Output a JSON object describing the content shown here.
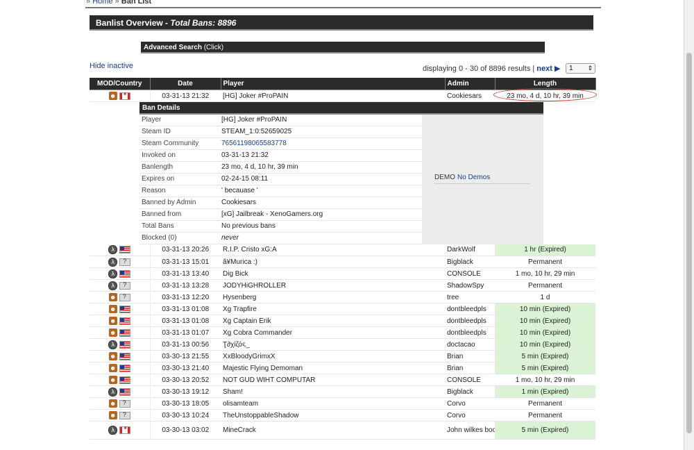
{
  "breadcrumb": {
    "home": "Home",
    "sep": "»",
    "current": "Ban List"
  },
  "overview": {
    "title": "Banlist Overview - ",
    "total": "Total Bans: 8896"
  },
  "advanced_search": {
    "label": "Advanced Search",
    "hint": " (Click)"
  },
  "hide_inactive": "Hide inactive",
  "pager": {
    "displaying": "displaying 0 - 30 of 8896 results | ",
    "next": "next ▶",
    "page": "1"
  },
  "columns": {
    "mod": "MOD/Country",
    "date": "Date",
    "player": "Player",
    "admin": "Admin",
    "length": "Length"
  },
  "first_ban": {
    "icon": "cs-icon",
    "flag": "ca",
    "date": "03-31-13 21:32",
    "player": "[HG] Joker #ProPAIN",
    "admin": "Cookiesars",
    "length": "23 mo, 4 d, 10 hr, 39 min"
  },
  "details": {
    "header": "Ban Details",
    "rows": [
      {
        "label": "Player",
        "value": "[HG] Joker #ProPAIN"
      },
      {
        "label": "Steam ID",
        "value": "STEAM_1:0:52659025"
      },
      {
        "label": "Steam Community",
        "value": "76561198065583778",
        "link": true
      },
      {
        "label": "Invoked on",
        "value": "03-31-13 21:32"
      },
      {
        "label": "Banlength",
        "value": "23 mo, 4 d, 10 hr, 39 min"
      },
      {
        "label": "Expires on",
        "value": "02-24-15 08:11"
      },
      {
        "label": "Reason",
        "value": "' becauase '"
      },
      {
        "label": "Banned by Admin",
        "value": "Cookiesars"
      },
      {
        "label": "Banned from",
        "value": "[xG] Jailbreak - XenoGamers.org"
      },
      {
        "label": "Total Bans",
        "value": "No previous bans"
      },
      {
        "label": "Blocked (0)",
        "value": "never",
        "italic": true
      }
    ],
    "demo": "No Demos",
    "demo_icon_text": "DEMO"
  },
  "bans": [
    {
      "icon": "hl",
      "flag": "us",
      "date": "03-31-13 20:26",
      "player": "R.I.P. Cristo xG:A",
      "admin": "DarkWolf",
      "length": "1 hr (Expired)",
      "expired": true
    },
    {
      "icon": "hl",
      "flag": "unk",
      "date": "03-31-13 15:01",
      "player": "â¥Murica :)",
      "admin": "Bigblack",
      "length": "Permanent",
      "expired": false
    },
    {
      "icon": "hl",
      "flag": "us",
      "date": "03-31-13 13:40",
      "player": "Dig Bick",
      "admin": "CONSOLE",
      "length": "1 mo, 10 hr, 29 min",
      "expired": false
    },
    {
      "icon": "hl",
      "flag": "unk",
      "date": "03-31-13 13:28",
      "player": "JODYHiGHROLLER",
      "admin": "ShadowSpy",
      "length": "Permanent",
      "expired": false
    },
    {
      "icon": "cs",
      "flag": "unk",
      "date": "03-31-13 12:20",
      "player": "Hysenberg",
      "admin": "tree",
      "length": "1 d",
      "expired": false
    },
    {
      "icon": "cs",
      "flag": "us",
      "date": "03-31-13 01:08",
      "player": "Xg Trapfire",
      "admin": "dontbleedpls",
      "length": "10 min (Expired)",
      "expired": true
    },
    {
      "icon": "cs",
      "flag": "us",
      "date": "03-31-13 01:08",
      "player": "Xg Captain Erik",
      "admin": "dontbleedpls",
      "length": "10 min (Expired)",
      "expired": true
    },
    {
      "icon": "cs",
      "flag": "us",
      "date": "03-31-13 01:07",
      "player": "Xg Cobra Commander",
      "admin": "dontbleedpls",
      "length": "10 min (Expired)",
      "expired": true
    },
    {
      "icon": "hl",
      "flag": "us",
      "date": "03-31-13 00:56",
      "player": "Ʈ∂χίζό૬_",
      "admin": "doctacao",
      "length": "10 min (Expired)",
      "expired": true
    },
    {
      "icon": "cs",
      "flag": "us",
      "date": "03-30-13 21:55",
      "player": "XxBloodyGrimxX",
      "admin": "Brian",
      "length": "5 min (Expired)",
      "expired": true
    },
    {
      "icon": "cs",
      "flag": "us",
      "date": "03-30-13 21:40",
      "player": "Majestic Flying Demoman",
      "admin": "Brian",
      "length": "5 min (Expired)",
      "expired": true
    },
    {
      "icon": "cs",
      "flag": "us",
      "date": "03-30-13 20:52",
      "player": "NOT GUD WIHT COMPUTAR",
      "admin": "CONSOLE",
      "length": "1 mo, 10 hr, 29 min",
      "expired": false
    },
    {
      "icon": "hl",
      "flag": "us",
      "date": "03-30-13 19:12",
      "player": "Sham!",
      "admin": "Bigblack",
      "length": "1 min (Expired)",
      "expired": true
    },
    {
      "icon": "cs",
      "flag": "unk",
      "date": "03-30-13 18:05",
      "player": "olisamteam",
      "admin": "Corvo",
      "length": "Permanent",
      "expired": false
    },
    {
      "icon": "cs",
      "flag": "unk",
      "date": "03-30-13 10:24",
      "player": "TheUnstoppableShadow",
      "admin": "Corvo",
      "length": "Permanent",
      "expired": false
    },
    {
      "icon": "hl",
      "flag": "ca",
      "date": "03-30-13 03:02",
      "player": "MineCrack",
      "admin": "John wilkes booth",
      "length": "5 min (Expired)",
      "expired": true,
      "tall": true
    }
  ]
}
